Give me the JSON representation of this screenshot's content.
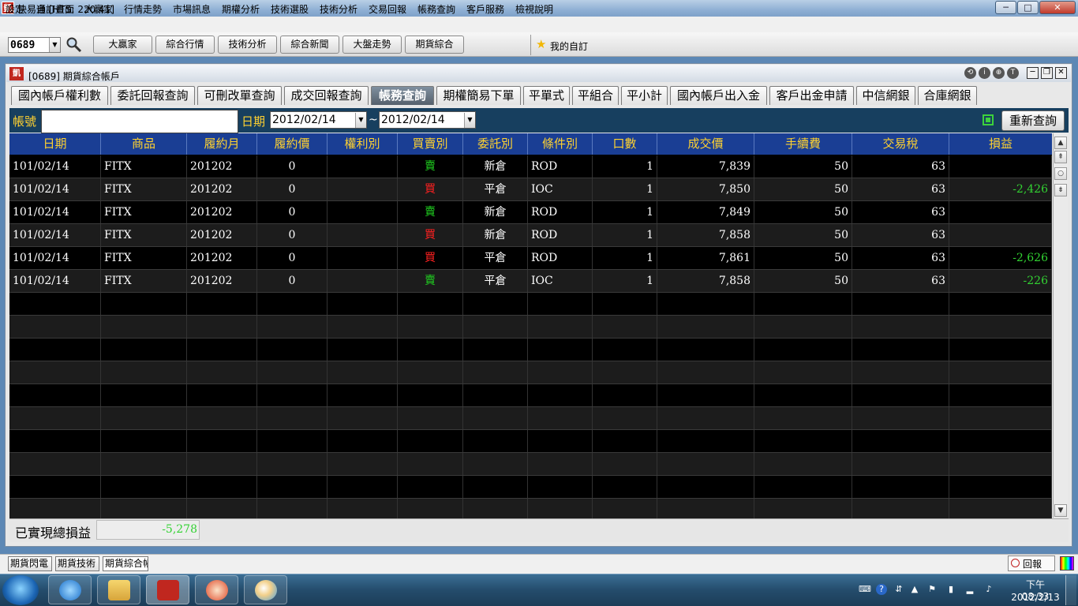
{
  "app": {
    "logo_text": "凱",
    "title": "快易通  [HTS: 220 41]",
    "win_buttons": [
      "─",
      "□",
      "✕"
    ]
  },
  "menu": [
    "設定",
    "自訂畫面",
    "大贏家",
    "行情走勢",
    "市場訊息",
    "期權分析",
    "技術選股",
    "技術分析",
    "交易回報",
    "帳務查詢",
    "客戶服務",
    "檢視說明"
  ],
  "toolbar": {
    "code_value": "0689",
    "buttons": [
      "大贏家",
      "綜合行情",
      "技術分析",
      "綜合新聞",
      "大盤走勢",
      "期貨綜合"
    ],
    "favorites_label": "我的自訂"
  },
  "window": {
    "logo_text": "凱",
    "title": "[0689] 期貨綜合帳戶",
    "circle_buttons": [
      "⟲",
      "i",
      "⊕",
      "T"
    ],
    "buttons": [
      "─",
      "❐",
      "✕"
    ]
  },
  "tabs": [
    "國內帳戶權利數",
    "委託回報查詢",
    "可刪改單查詢",
    "成交回報查詢",
    "帳務查詢",
    "期權簡易下單",
    "平單式",
    "平組合",
    "平小計",
    "國內帳戶出入金",
    "客戶出金申請",
    "中信網銀",
    "合庫網銀"
  ],
  "active_tab": "帳務查詢",
  "filter": {
    "account_label": "帳號",
    "account_value": "",
    "date_label": "日期",
    "date_from": "2012/02/14",
    "tilde": "~",
    "date_to": "2012/02/14",
    "requery_label": "重新查詢"
  },
  "table": {
    "columns": [
      "日期",
      "商品",
      "履約月",
      "履約價",
      "權利別",
      "買賣別",
      "委託別",
      "條件別",
      "口數",
      "成交價",
      "手續費",
      "交易稅",
      "損益"
    ],
    "rows": [
      [
        "101/02/14",
        "FITX",
        "201202",
        "0",
        "",
        "賣",
        "新倉",
        "ROD",
        "1",
        "7,839",
        "50",
        "63",
        ""
      ],
      [
        "101/02/14",
        "FITX",
        "201202",
        "0",
        "",
        "買",
        "平倉",
        "IOC",
        "1",
        "7,850",
        "50",
        "63",
        "-2,426"
      ],
      [
        "101/02/14",
        "FITX",
        "201202",
        "0",
        "",
        "賣",
        "新倉",
        "ROD",
        "1",
        "7,849",
        "50",
        "63",
        ""
      ],
      [
        "101/02/14",
        "FITX",
        "201202",
        "0",
        "",
        "買",
        "新倉",
        "ROD",
        "1",
        "7,858",
        "50",
        "63",
        ""
      ],
      [
        "101/02/14",
        "FITX",
        "201202",
        "0",
        "",
        "買",
        "平倉",
        "ROD",
        "1",
        "7,861",
        "50",
        "63",
        "-2,626"
      ],
      [
        "101/02/14",
        "FITX",
        "201202",
        "0",
        "",
        "賣",
        "平倉",
        "IOC",
        "1",
        "7,858",
        "50",
        "63",
        "-226"
      ]
    ],
    "empty_rows": 10
  },
  "summary": {
    "label": "已實現總損益",
    "value": "-5,278"
  },
  "window_tabs": [
    "期貨閃電",
    "期貨技術",
    "期貨綜合帳戶"
  ],
  "report_label": "回報",
  "colors": {
    "sell": "#20d020",
    "buy": "#ff2020",
    "profit_negative": "#32d232",
    "header_bg": "#1a3e94",
    "header_text": "#ffd230"
  },
  "taskbar": {
    "icons": [
      "windows-start-icon",
      "ie-icon",
      "explorer-icon",
      "hts-app-icon",
      "game-icon",
      "paint-icon"
    ],
    "time": "下午 08:33",
    "date": "2012/2/13"
  }
}
